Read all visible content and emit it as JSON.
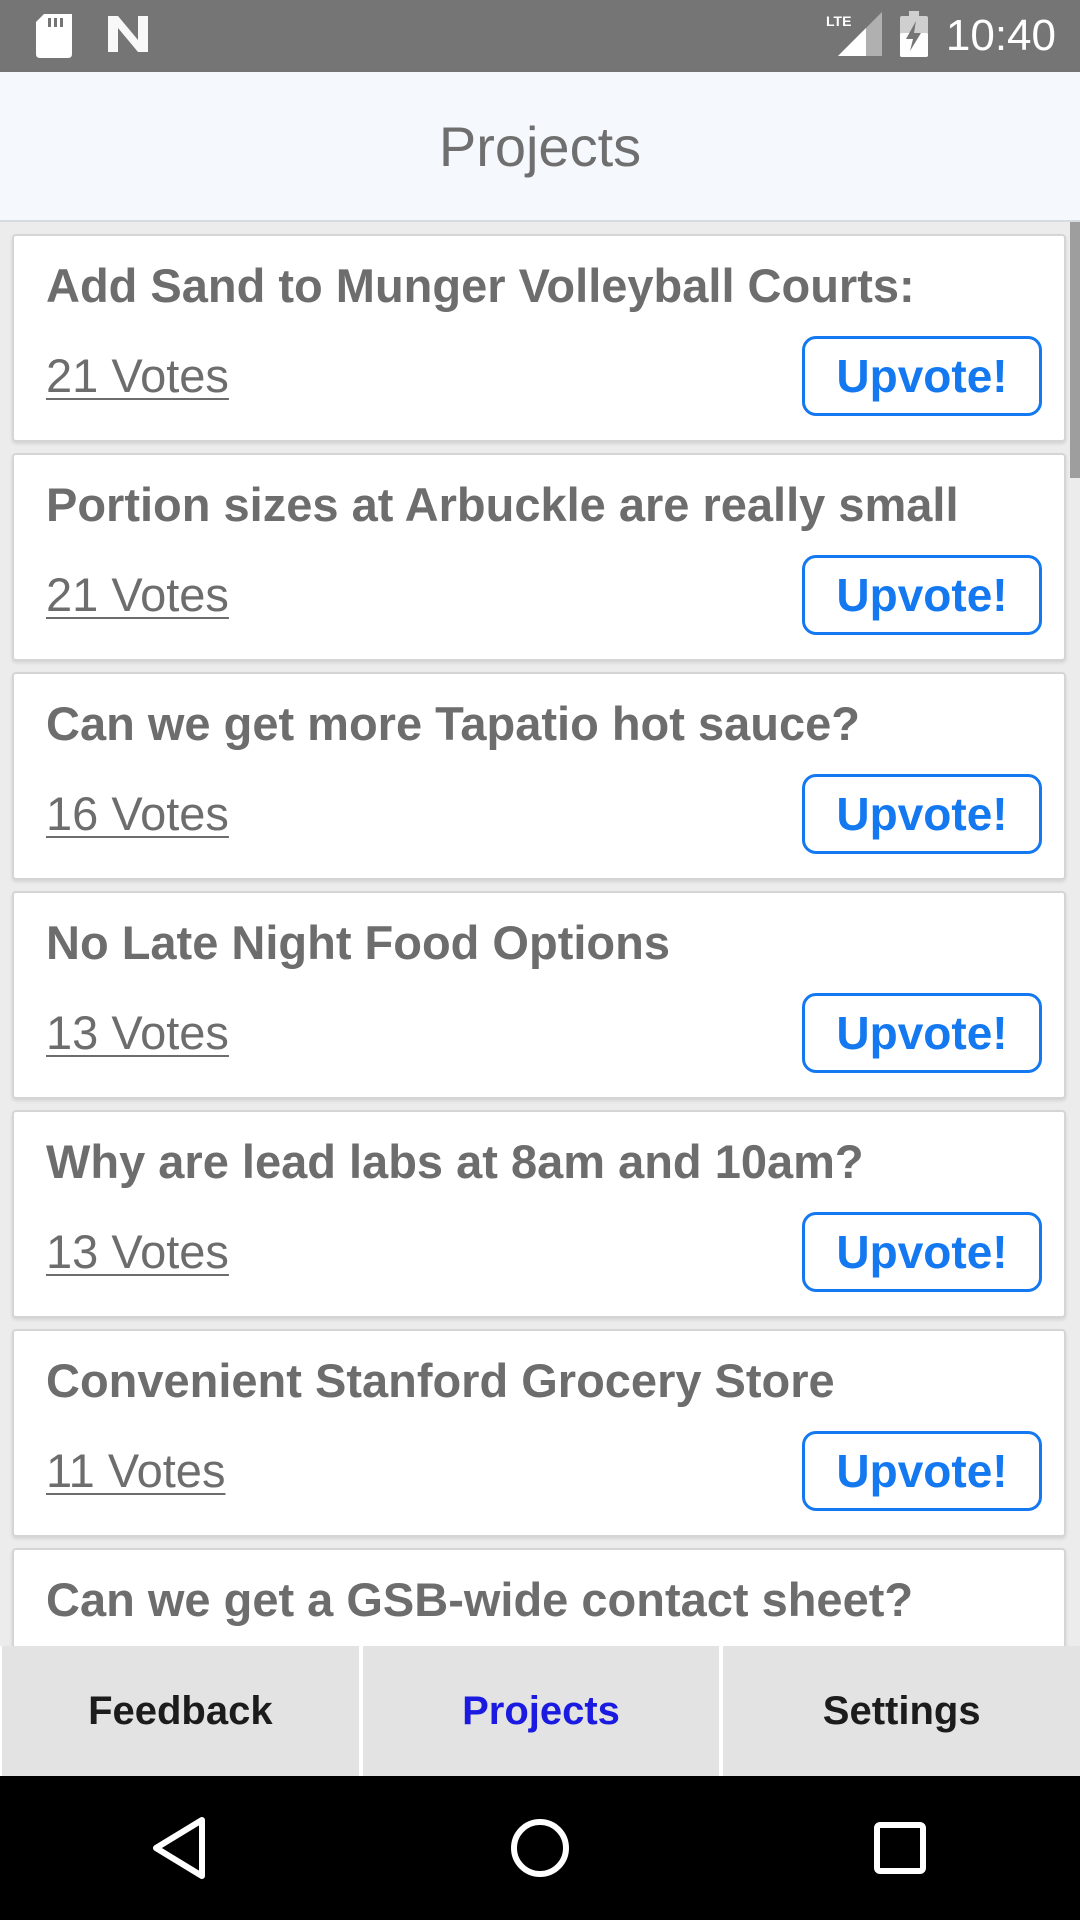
{
  "status_bar": {
    "time": "10:40",
    "network": "LTE",
    "icons": [
      "sd-card-icon",
      "n-notification-icon",
      "lte-signal-icon",
      "battery-icon"
    ]
  },
  "header": {
    "title": "Projects"
  },
  "projects": [
    {
      "title": "Add Sand to Munger Volleyball Courts:",
      "votes": "21 Votes",
      "button": "Upvote!"
    },
    {
      "title": "Portion sizes at Arbuckle are really small",
      "votes": "21 Votes",
      "button": "Upvote!"
    },
    {
      "title": "Can we get more Tapatio hot sauce?",
      "votes": "16 Votes",
      "button": "Upvote!"
    },
    {
      "title": "No Late Night Food Options",
      "votes": "13 Votes",
      "button": "Upvote!"
    },
    {
      "title": "Why are lead labs at 8am and 10am?",
      "votes": "13 Votes",
      "button": "Upvote!"
    },
    {
      "title": "Convenient Stanford Grocery Store",
      "votes": "11 Votes",
      "button": "Upvote!"
    },
    {
      "title": "Can we get a GSB-wide contact sheet?",
      "votes": "",
      "button": ""
    }
  ],
  "tabs": [
    {
      "label": "Feedback",
      "active": false
    },
    {
      "label": "Projects",
      "active": true
    },
    {
      "label": "Settings",
      "active": false
    }
  ],
  "colors": {
    "accent": "#1478f0",
    "active_tab": "#1a1ae0",
    "status_bar": "#757575",
    "text_gray": "#6d6d6d"
  }
}
